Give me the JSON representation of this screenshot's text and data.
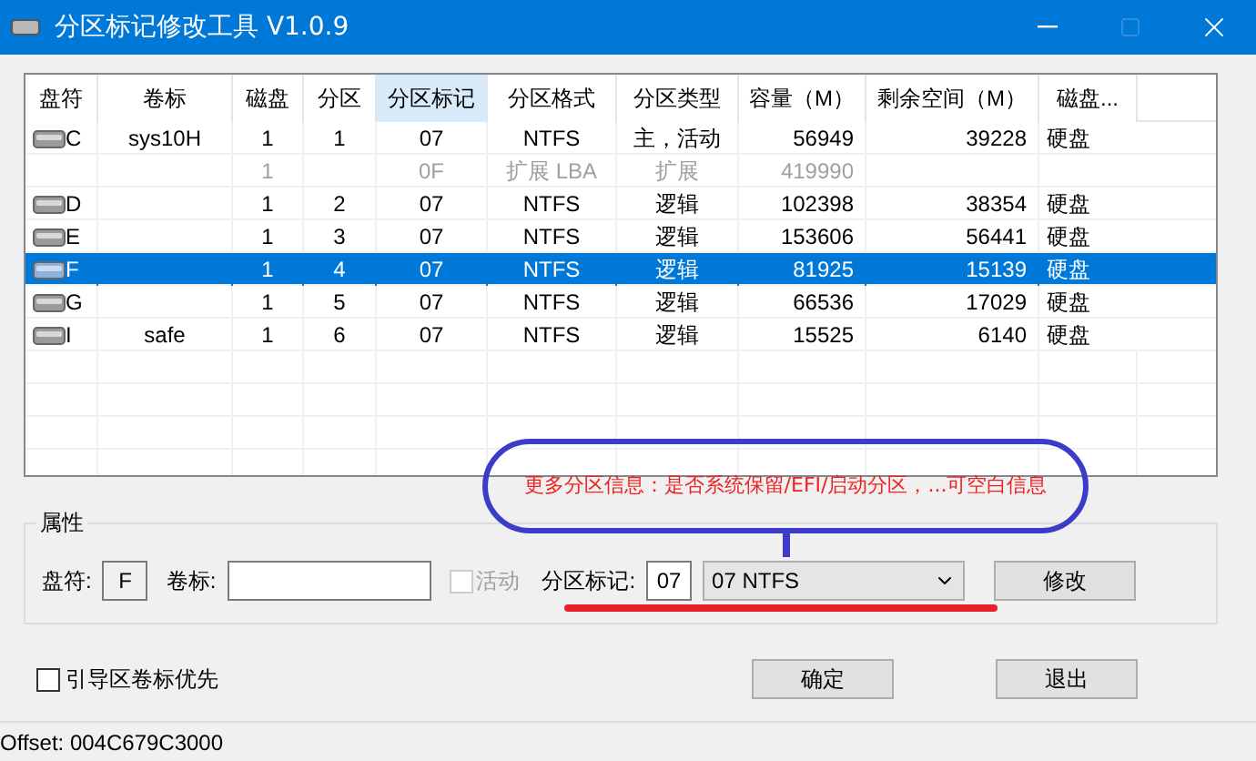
{
  "window": {
    "title": "分区标记修改工具 V1.0.9"
  },
  "table": {
    "columns": [
      {
        "label": "盘符",
        "selected": false
      },
      {
        "label": "卷标",
        "selected": false
      },
      {
        "label": "磁盘",
        "selected": false
      },
      {
        "label": "分区",
        "selected": false
      },
      {
        "label": "分区标记",
        "selected": true
      },
      {
        "label": "分区格式",
        "selected": false
      },
      {
        "label": "分区类型",
        "selected": false
      },
      {
        "label": "容量（M）",
        "selected": false
      },
      {
        "label": "剩余空间（M）",
        "selected": false
      },
      {
        "label": "磁盘...",
        "selected": false
      }
    ],
    "rows": [
      {
        "kind": "drive",
        "selected": false,
        "drive": "C",
        "label": "sys10H",
        "disk": "1",
        "partition": "1",
        "flag": "07",
        "format": "NTFS",
        "type": "主，活动",
        "capacity": "56949",
        "free": "39228",
        "media": "硬盘"
      },
      {
        "kind": "extended",
        "selected": false,
        "disk": "1",
        "flag": "0F",
        "format": "扩展 LBA",
        "type": "扩展",
        "capacity": "419990"
      },
      {
        "kind": "drive",
        "selected": false,
        "drive": "D",
        "disk": "1",
        "partition": "2",
        "flag": "07",
        "format": "NTFS",
        "type": "逻辑",
        "capacity": "102398",
        "free": "38354",
        "media": "硬盘"
      },
      {
        "kind": "drive",
        "selected": false,
        "drive": "E",
        "disk": "1",
        "partition": "3",
        "flag": "07",
        "format": "NTFS",
        "type": "逻辑",
        "capacity": "153606",
        "free": "56441",
        "media": "硬盘"
      },
      {
        "kind": "drive",
        "selected": true,
        "drive": "F",
        "disk": "1",
        "partition": "4",
        "flag": "07",
        "format": "NTFS",
        "type": "逻辑",
        "capacity": "81925",
        "free": "15139",
        "media": "硬盘"
      },
      {
        "kind": "drive",
        "selected": false,
        "drive": "G",
        "disk": "1",
        "partition": "5",
        "flag": "07",
        "format": "NTFS",
        "type": "逻辑",
        "capacity": "66536",
        "free": "17029",
        "media": "硬盘"
      },
      {
        "kind": "drive",
        "selected": false,
        "drive": "I",
        "label": "safe",
        "disk": "1",
        "partition": "6",
        "flag": "07",
        "format": "NTFS",
        "type": "逻辑",
        "capacity": "15525",
        "free": "6140",
        "media": "硬盘"
      }
    ]
  },
  "properties": {
    "title": "属性",
    "drive_label": "盘符:",
    "drive_value": "F",
    "volume_label": "卷标:",
    "active": {
      "label": "活动",
      "checked": false,
      "disabled": true
    },
    "flag_label": "分区标记:",
    "flag_value": "07",
    "format_select": "07 NTFS",
    "modify_button": "修改"
  },
  "boot_label_priority": {
    "label": "引导区卷标优先",
    "checked": false
  },
  "buttons": [
    "确定",
    "退出"
  ],
  "status_bar": "Offset: 004C679C3000",
  "annotation": {
    "text": "更多分区信息：是否系统保留/EFI/启动分区，...可空白信息"
  }
}
